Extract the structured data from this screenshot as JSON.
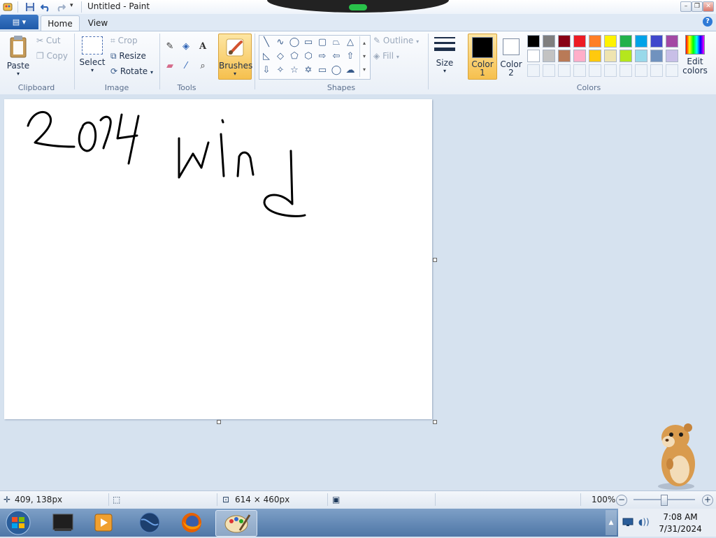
{
  "window": {
    "title": "Untitled - Paint"
  },
  "tabs": {
    "home": "Home",
    "view": "View"
  },
  "help": "?",
  "ribbon": {
    "clipboard": {
      "paste": "Paste",
      "cut": "Cut",
      "copy": "Copy",
      "group": "Clipboard"
    },
    "image": {
      "select": "Select",
      "crop": "Crop",
      "resize": "Resize",
      "rotate": "Rotate",
      "group": "Image"
    },
    "tools": {
      "group": "Tools",
      "text_tool": "A"
    },
    "brushes": {
      "label": "Brushes"
    },
    "shapes": {
      "group": "Shapes",
      "outline": "Outline",
      "fill": "Fill"
    },
    "size": {
      "label": "Size"
    },
    "color1": {
      "label_line1": "Color",
      "label_line2": "1",
      "value": "#000000"
    },
    "color2": {
      "label_line1": "Color",
      "label_line2": "2",
      "value": "#ffffff"
    },
    "colors": {
      "group": "Colors",
      "row1": [
        "#000000",
        "#7f7f7f",
        "#880015",
        "#ed1c24",
        "#ff7f27",
        "#fff200",
        "#22b14c",
        "#00a2e8",
        "#3f48cc",
        "#a349a4"
      ],
      "row2": [
        "#ffffff",
        "#c3c3c3",
        "#b97a57",
        "#ffaec9",
        "#ffc90e",
        "#efe4b0",
        "#b5e61d",
        "#99d9ea",
        "#7092be",
        "#c8bfe7"
      ]
    },
    "edit_colors": {
      "line1": "Edit",
      "line2": "colors"
    }
  },
  "status": {
    "cursor_pos": "409, 138px",
    "canvas_size": "614 × 460px",
    "zoom": "100%"
  },
  "taskbar": {
    "time": "7:08 AM",
    "date": "7/31/2024"
  }
}
